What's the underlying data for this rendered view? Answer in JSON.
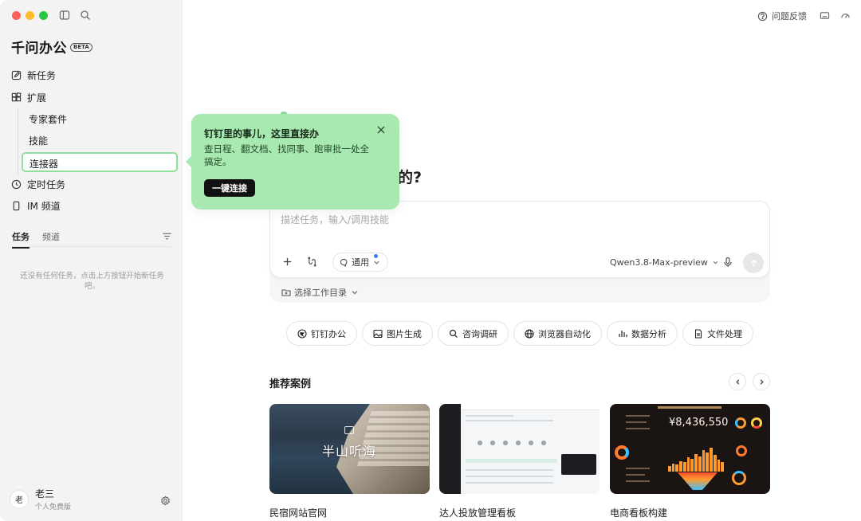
{
  "sidebar": {
    "brand": "千问办公",
    "badge": "BETA",
    "nav": {
      "new_task": "新任务",
      "extensions": "扩展",
      "expert_kits": "专家套件",
      "skills": "技能",
      "connectors": "连接器",
      "scheduled": "定时任务",
      "im_channel": "IM 频道"
    },
    "tabs": {
      "tasks": "任务",
      "channels": "频道"
    },
    "empty_text": "还没有任何任务，点击上方按钮开始新任务吧。",
    "user": {
      "avatar": "老",
      "name": "老三",
      "plan": "个人免费版"
    }
  },
  "header": {
    "feedback": "问题反馈"
  },
  "popover": {
    "title": "钉钉里的事儿，这里直接办",
    "description": "查日程、翻文档、找同事、跑审批一处全搞定。",
    "button": "一键连接"
  },
  "main": {
    "headline_visible": "的?",
    "composer_placeholder": "描述任务，输入/调用技能",
    "mode": "通用",
    "model": "Qwen3.8-Max-preview",
    "workdir": "选择工作目录",
    "chips": [
      "钉钉办公",
      "图片生成",
      "咨询调研",
      "浏览器自动化",
      "数据分析",
      "文件处理"
    ],
    "recommend_title": "推荐案例",
    "cards": [
      {
        "label": "民宿网站官网",
        "overlay": "半山听海"
      },
      {
        "label": "达人投放管理看板"
      },
      {
        "label": "电商看板构建",
        "number": "¥8,436,550"
      }
    ]
  },
  "colors": {
    "popover_bg": "#a8e8b1",
    "selected_border": "#8fe09a",
    "accent_dot": "#3a7bff"
  }
}
